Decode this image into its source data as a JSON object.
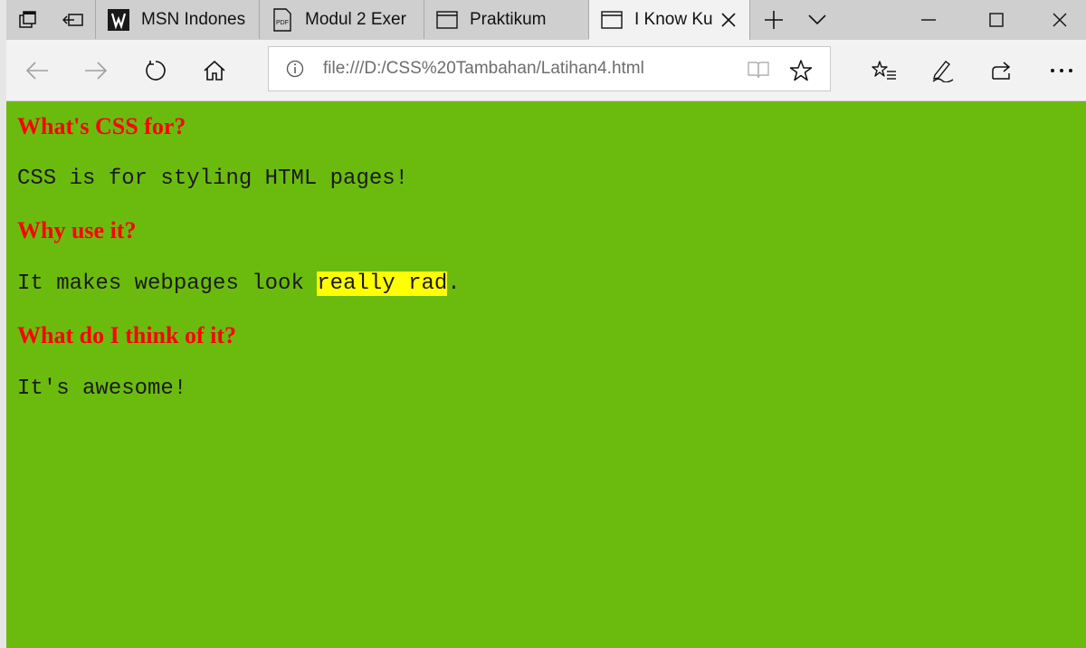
{
  "tabs": [
    {
      "label": "MSN Indones",
      "icon": "msn-icon"
    },
    {
      "label": "Modul 2 Exer",
      "icon": "pdf-icon"
    },
    {
      "label": "Praktikum",
      "icon": "page-icon"
    },
    {
      "label": "I Know Ku",
      "icon": "page-icon",
      "active": true
    }
  ],
  "address": {
    "url": "file:///D:/CSS%20Tambahan/Latihan4.html"
  },
  "content": {
    "heading1": "What's CSS for?",
    "para1": "CSS is for styling HTML pages!",
    "heading2": "Why use it?",
    "para2_before": "It makes webpages look ",
    "para2_highlight": "really rad",
    "para2_after": ".",
    "heading3": "What do I think of it?",
    "para3": "It's awesome!"
  },
  "colors": {
    "page_background": "#6bbb0f",
    "heading": "#ff0000",
    "highlight": "#ffff00"
  }
}
